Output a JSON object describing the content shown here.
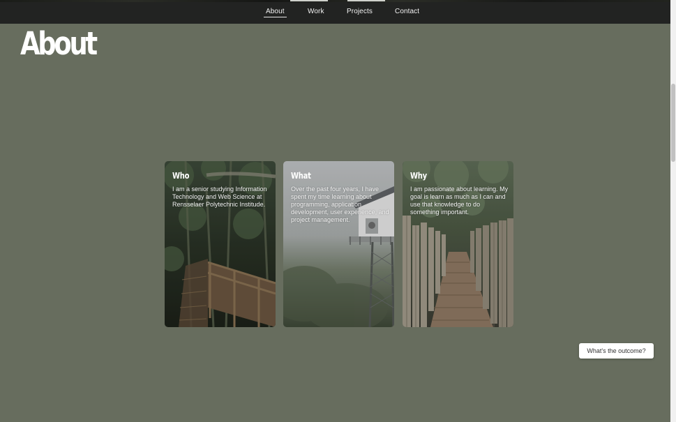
{
  "nav": {
    "items": [
      {
        "label": "About",
        "active": true
      },
      {
        "label": "Work",
        "active": false
      },
      {
        "label": "Projects",
        "active": false
      },
      {
        "label": "Contact",
        "active": false
      }
    ]
  },
  "page_title": "About",
  "cards": [
    {
      "title": "Who",
      "text": "I am a senior studying Information Technology and Web Science at Rensselaer Polytechnic Institude."
    },
    {
      "title": "What",
      "text": "Over the past four years, I have spent my time learning about programming, application development, user experience, and project management."
    },
    {
      "title": "Why",
      "text": "I am passionate about learning. My goal is learn as much as I can and use that knowledge to do something important."
    }
  ],
  "outcome_button": {
    "label": "What's the outcome?"
  },
  "colors": {
    "background": "#676d5e",
    "navbar": "#222322",
    "text": "#ffffff"
  }
}
